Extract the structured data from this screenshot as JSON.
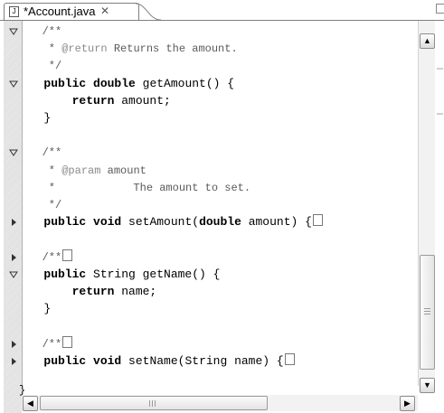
{
  "tab": {
    "title": "*Account.java",
    "close": "✕",
    "file_icon": "J"
  },
  "code_lines": [
    {
      "text": "   /**",
      "fold": "expanded"
    },
    {
      "text": "    * @return Returns the amount.",
      "fold": "none"
    },
    {
      "text": "    */",
      "fold": "none"
    },
    {
      "text": "   public double getAmount() {",
      "fold": "expanded"
    },
    {
      "text": "       return amount;",
      "fold": "none"
    },
    {
      "text": "   }",
      "fold": "none"
    },
    {
      "text": "",
      "fold": "none"
    },
    {
      "text": "   /**",
      "fold": "expanded"
    },
    {
      "text": "    * @param amount",
      "fold": "none"
    },
    {
      "text": "    *            The amount to set.",
      "fold": "none"
    },
    {
      "text": "    */",
      "fold": "none"
    },
    {
      "text": "   public void setAmount(double amount) {",
      "fold": "collapsed"
    },
    {
      "text": "",
      "fold": "none"
    },
    {
      "text": "   /**",
      "fold": "collapsed"
    },
    {
      "text": "   public String getName() {",
      "fold": "expanded"
    },
    {
      "text": "       return name;",
      "fold": "none"
    },
    {
      "text": "   }",
      "fold": "none"
    },
    {
      "text": "",
      "fold": "none"
    },
    {
      "text": "   /**",
      "fold": "collapsed"
    },
    {
      "text": "   public void setName(String name) {",
      "fold": "collapsed"
    }
  ],
  "closing_brace": "}",
  "scrollbars": {
    "vertical_up": "▲",
    "vertical_down": "▼",
    "horizontal_left": "◀",
    "horizontal_right": "▶",
    "vertical_position_percent": 70,
    "horizontal_position_percent": 0
  },
  "icons": [
    "java-file-icon",
    "close-icon",
    "maximize-icon",
    "fold-expanded-icon",
    "fold-collapsed-icon"
  ]
}
